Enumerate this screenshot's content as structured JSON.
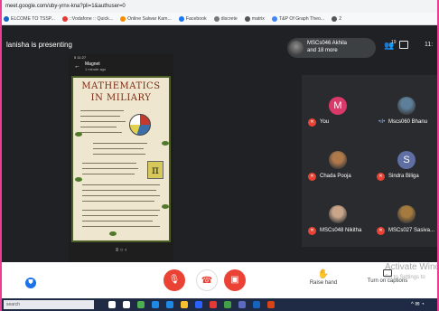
{
  "browser": {
    "url": "meet.google.com/uby-yrnx-kna?pli=1&authuser=0",
    "bookmarks": [
      {
        "label": "ELCOME TO TSSP...",
        "color": "#1565c0"
      },
      {
        "label": "::Vodafone :: Quick...",
        "color": "#e53935"
      },
      {
        "label": "Online Salwar Kam...",
        "color": "#fb8c00"
      },
      {
        "label": "Facebook",
        "color": "#1877f2"
      },
      {
        "label": "discrete",
        "color": "#777777"
      },
      {
        "label": "matrix",
        "color": "#555555"
      },
      {
        "label": "T&P Of Graph Theo...",
        "color": "#4285f4"
      },
      {
        "label": "2",
        "color": "#555555"
      }
    ]
  },
  "meet": {
    "presenting_label": "lanisha is presenting",
    "host_name": "MSCs046 Akhila",
    "host_more": "and 18 more",
    "people_count": "19",
    "clock": "11:"
  },
  "phone": {
    "status": "5 11:27",
    "chat_name": "Magnet",
    "chat_time": "1 minute ago",
    "nav": "≡   ○   ‹"
  },
  "poster": {
    "title_line1": "MATHEMATICS",
    "title_line2": "IN MILIARY",
    "pi_symbol": "π"
  },
  "participants": [
    {
      "name": "You",
      "initial": "M",
      "avatar_color": "#d93a69",
      "muted": true
    },
    {
      "name": "Mscs060 Bhanu",
      "initial": "",
      "avatar_color": "#5d7f9a",
      "muted": false
    },
    {
      "name": "Chada Pooja",
      "initial": "",
      "avatar_color": "#b0794a",
      "muted": true
    },
    {
      "name": "Sindra Biliga",
      "initial": "S",
      "avatar_color": "#5f6fa3",
      "muted": true
    },
    {
      "name": "MSCs048 Nikitha",
      "initial": "",
      "avatar_color": "#c9a58a",
      "muted": true
    },
    {
      "name": "MSCs027 Sasiva...",
      "initial": "",
      "avatar_color": "#a57a3e",
      "muted": true
    }
  ],
  "controls": {
    "raise_hand": "Raise hand",
    "captions": "Turn on captions",
    "watermark_line1": "Activate Wind",
    "watermark_line2": "Go to Settings to"
  },
  "taskbar": {
    "search_placeholder": "search",
    "apps": [
      {
        "name": "search-task-icon",
        "color": "#ffffff"
      },
      {
        "name": "task-view-icon",
        "color": "#ffffff"
      },
      {
        "name": "chrome-icon",
        "color": "#4caf50"
      },
      {
        "name": "edge-icon",
        "color": "#1e88e5"
      },
      {
        "name": "mail-icon",
        "color": "#1e88e5"
      },
      {
        "name": "explorer-icon",
        "color": "#fbc02d"
      },
      {
        "name": "store-icon",
        "color": "#2962ff"
      },
      {
        "name": "chrome2-icon",
        "color": "#e53935"
      },
      {
        "name": "maps-icon",
        "color": "#43a047"
      },
      {
        "name": "teams-icon",
        "color": "#5c6bc0"
      },
      {
        "name": "word-icon",
        "color": "#1565c0"
      },
      {
        "name": "powerpoint-icon",
        "color": "#d84315"
      }
    ]
  }
}
